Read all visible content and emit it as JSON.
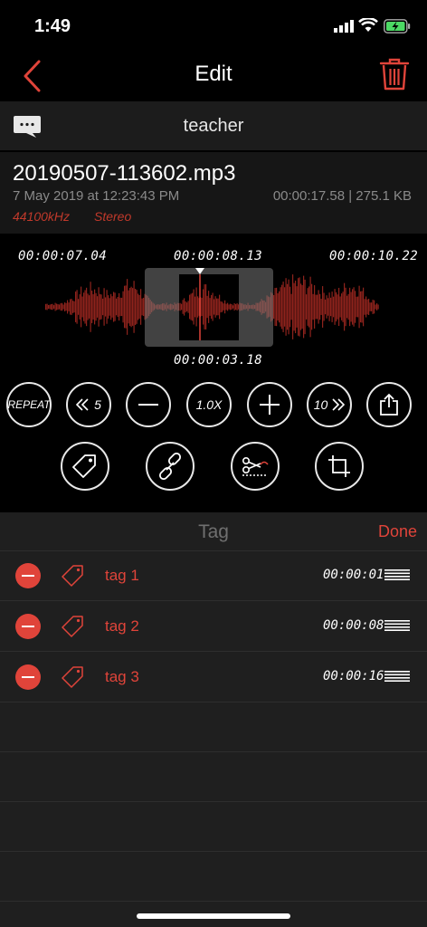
{
  "status": {
    "time": "1:49"
  },
  "nav": {
    "title": "Edit"
  },
  "header": {
    "title": "teacher"
  },
  "file": {
    "name": "20190507-113602.mp3",
    "date": "7 May 2019 at 12:23:43 PM",
    "meta": "00:00:17.58 | 275.1 KB",
    "rate": "44100kHz",
    "mode": "Stereo"
  },
  "waveform": {
    "start": "00:00:07.04",
    "position": "00:00:08.13",
    "end": "00:00:10.22",
    "selection": "00:00:03.18"
  },
  "controls": {
    "repeat": "REPEAT",
    "back": "5",
    "speed": "1.0X",
    "forward": "10"
  },
  "tags": {
    "title": "Tag",
    "done": "Done",
    "items": [
      {
        "label": "tag 1",
        "time": "00:00:01"
      },
      {
        "label": "tag 2",
        "time": "00:00:08"
      },
      {
        "label": "tag 3",
        "time": "00:00:16"
      }
    ]
  },
  "colors": {
    "accent": "#e0443a",
    "wave": "#8e231c",
    "background": "#000000"
  }
}
